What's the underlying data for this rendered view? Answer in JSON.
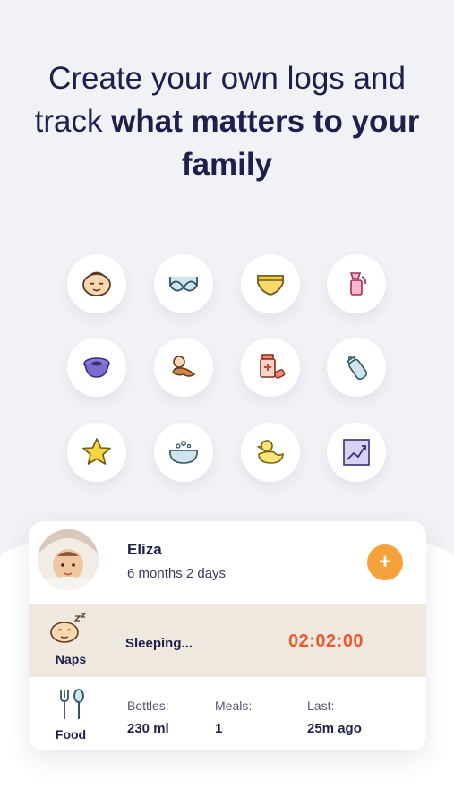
{
  "headline": {
    "line1": "Create your own logs and",
    "line2_normal": "track ",
    "line2_bold": "what matters to your",
    "line3_bold": "family"
  },
  "log_icons": [
    "baby-face-icon",
    "bra-icon",
    "diaper-icon",
    "breast-pump-icon",
    "potty-icon",
    "tummy-time-icon",
    "medicine-icon",
    "bottle-icon",
    "star-icon",
    "bath-icon",
    "rubber-duck-icon",
    "growth-chart-icon"
  ],
  "colors": {
    "accent_orange": "#f5a23a",
    "timer_red": "#ee5a2e",
    "navy": "#1f1f4d",
    "naps_bg": "#efe8df"
  },
  "profile": {
    "name": "Eliza",
    "age": "6 months 2 days",
    "add_symbol": "+"
  },
  "naps": {
    "label": "Naps",
    "status": "Sleeping...",
    "timer": "02:02:00"
  },
  "food": {
    "label": "Food",
    "stats": [
      {
        "label": "Bottles:",
        "value": "230 ml"
      },
      {
        "label": "Meals:",
        "value": "1"
      },
      {
        "label": "Last:",
        "value": "25m ago"
      }
    ]
  }
}
